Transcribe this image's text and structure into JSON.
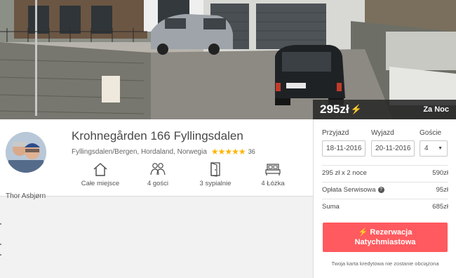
{
  "hero": {
    "price": "295zł",
    "per_night": "Za Noc"
  },
  "listing": {
    "title": "Krohnegården 166 Fyllingsdalen",
    "location": "Fyllingsdalen/Bergen, Hordaland, Norwegia",
    "rating": 5,
    "review_count": "36",
    "host_name": "Thor Asbjørn",
    "amenities": [
      {
        "icon": "house-icon",
        "label": "Całe miejsce"
      },
      {
        "icon": "guests-icon",
        "label": "4 gości"
      },
      {
        "icon": "door-icon",
        "label": "3 sypialnie"
      },
      {
        "icon": "bed-icon",
        "label": "4 Łóżka"
      }
    ]
  },
  "booking": {
    "checkin_label": "Przyjazd",
    "checkout_label": "Wyjazd",
    "guests_label": "Goście",
    "checkin_value": "18-11-2016",
    "checkout_value": "20-11-2016",
    "guests_value": "4",
    "breakdown": [
      {
        "label": "295 zł x 2 noce",
        "value": "590zł"
      },
      {
        "label": "Opłata Serwisowa",
        "value": "95zł"
      },
      {
        "label": "Suma",
        "value": "685zł"
      }
    ],
    "cta_line1": "Rezerwacja",
    "cta_line2": "Natychmiastowa",
    "note": "Twoja karta kredytowa nie zostanie obciążona"
  },
  "colors": {
    "accent": "#ff5a5f",
    "star": "#ffb400",
    "price_bar": "#282828"
  }
}
